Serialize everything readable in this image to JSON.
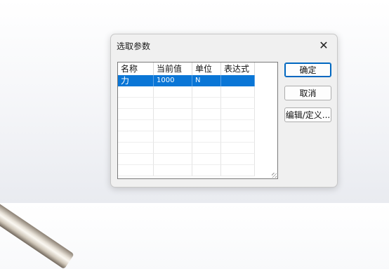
{
  "dialog": {
    "title": "选取参数",
    "close_glyph": "✕"
  },
  "table": {
    "columns": [
      "名称",
      "当前值",
      "单位",
      "表达式"
    ],
    "rows": [
      {
        "name": "力",
        "value": "1000",
        "unit": "N",
        "expression": "",
        "selected": true
      }
    ]
  },
  "buttons": {
    "ok": "确定",
    "cancel": "取消",
    "edit_define": "编辑/定义..."
  },
  "colors": {
    "selection": "#0a76d6",
    "accent_border": "#0067c0"
  }
}
